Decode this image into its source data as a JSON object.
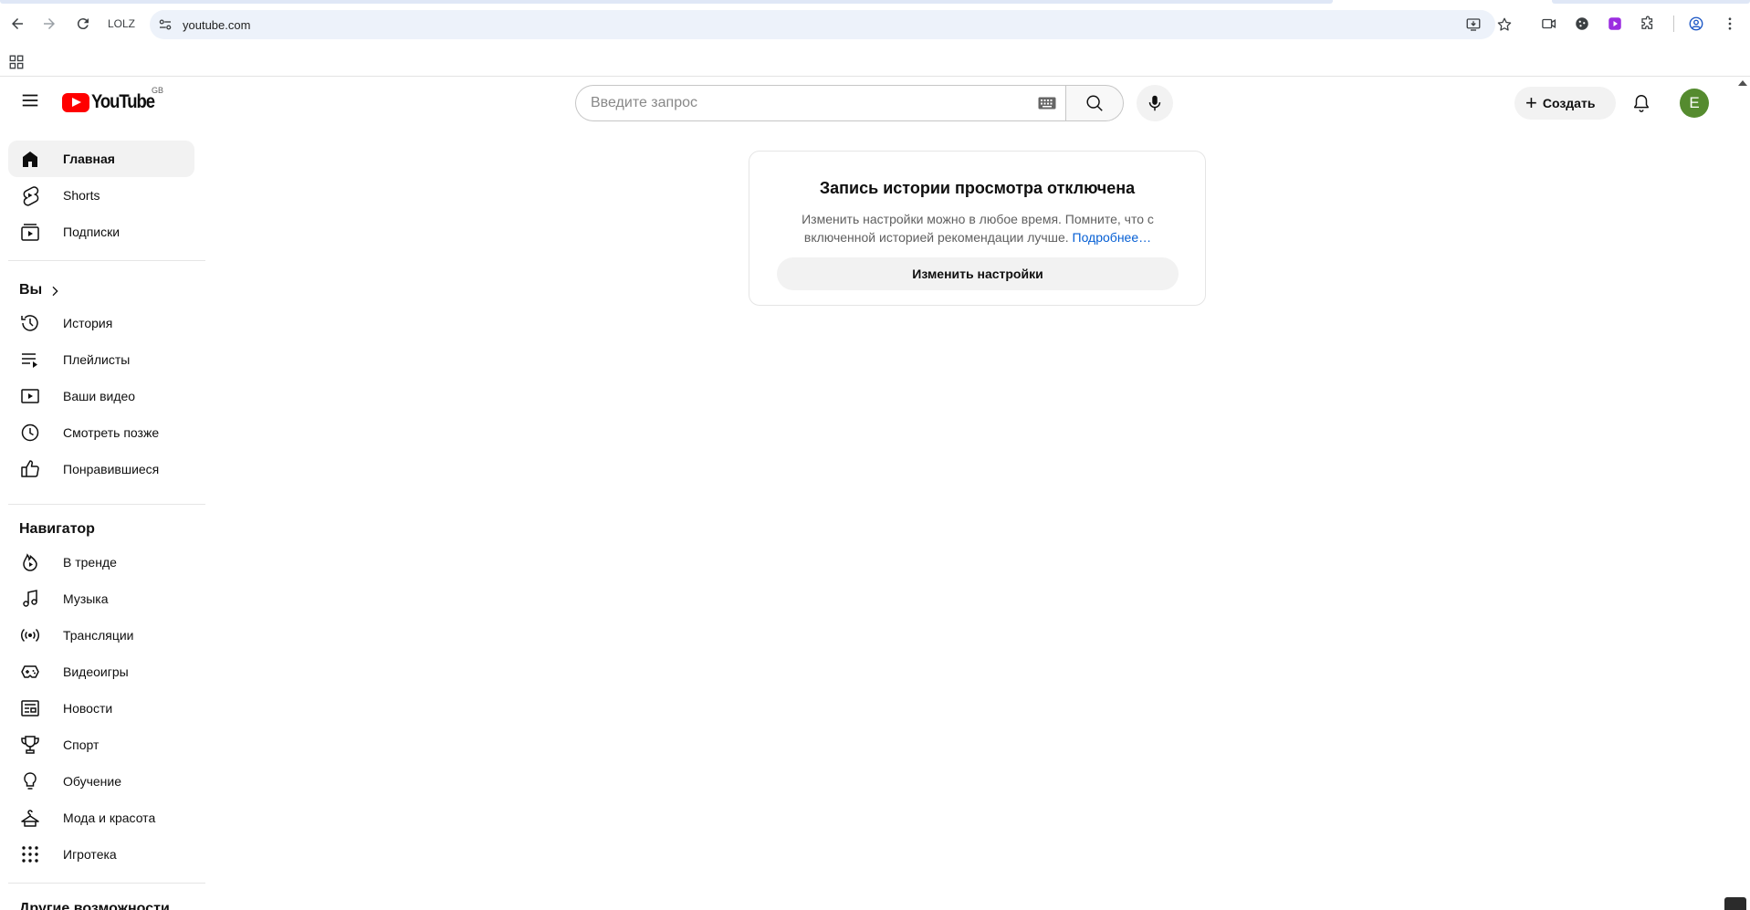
{
  "browser": {
    "profile_label": "LOLZ",
    "url": "youtube.com"
  },
  "masthead": {
    "logo_text": "YouTube",
    "country_code": "GB",
    "search_placeholder": "Введите запрос",
    "create_label": "Создать",
    "avatar_letter": "E"
  },
  "sidebar": {
    "main_items": [
      {
        "label": "Главная",
        "icon": "home-icon",
        "active": true
      },
      {
        "label": "Shorts",
        "icon": "shorts-icon"
      },
      {
        "label": "Подписки",
        "icon": "subscriptions-icon"
      }
    ],
    "you_title": "Вы",
    "you_items": [
      {
        "label": "История",
        "icon": "history-icon"
      },
      {
        "label": "Плейлисты",
        "icon": "playlists-icon"
      },
      {
        "label": "Ваши видео",
        "icon": "your-videos-icon"
      },
      {
        "label": "Смотреть позже",
        "icon": "watch-later-icon"
      },
      {
        "label": "Понравившиеся",
        "icon": "liked-icon"
      }
    ],
    "nav_title": "Навигатор",
    "nav_items": [
      {
        "label": "В тренде",
        "icon": "trending-icon"
      },
      {
        "label": "Музыка",
        "icon": "music-icon"
      },
      {
        "label": "Трансляции",
        "icon": "live-icon"
      },
      {
        "label": "Видеоигры",
        "icon": "gaming-icon"
      },
      {
        "label": "Новости",
        "icon": "news-icon"
      },
      {
        "label": "Спорт",
        "icon": "sports-icon"
      },
      {
        "label": "Обучение",
        "icon": "learning-icon"
      },
      {
        "label": "Мода и красота",
        "icon": "fashion-icon"
      },
      {
        "label": "Игротека",
        "icon": "playables-icon"
      }
    ],
    "more_title": "Другие возможности"
  },
  "history_card": {
    "title": "Запись истории просмотра отключена",
    "body": "Изменить настройки можно в любое время. Помните, что с включенной историей рекомендации лучше.",
    "link": "Подробнее…",
    "button": "Изменить настройки"
  },
  "colors": {
    "brand_red": "#ff0000",
    "link_blue": "#065fd4",
    "avatar_green": "#558b2f",
    "omnibox_bg": "#edf2fa"
  }
}
